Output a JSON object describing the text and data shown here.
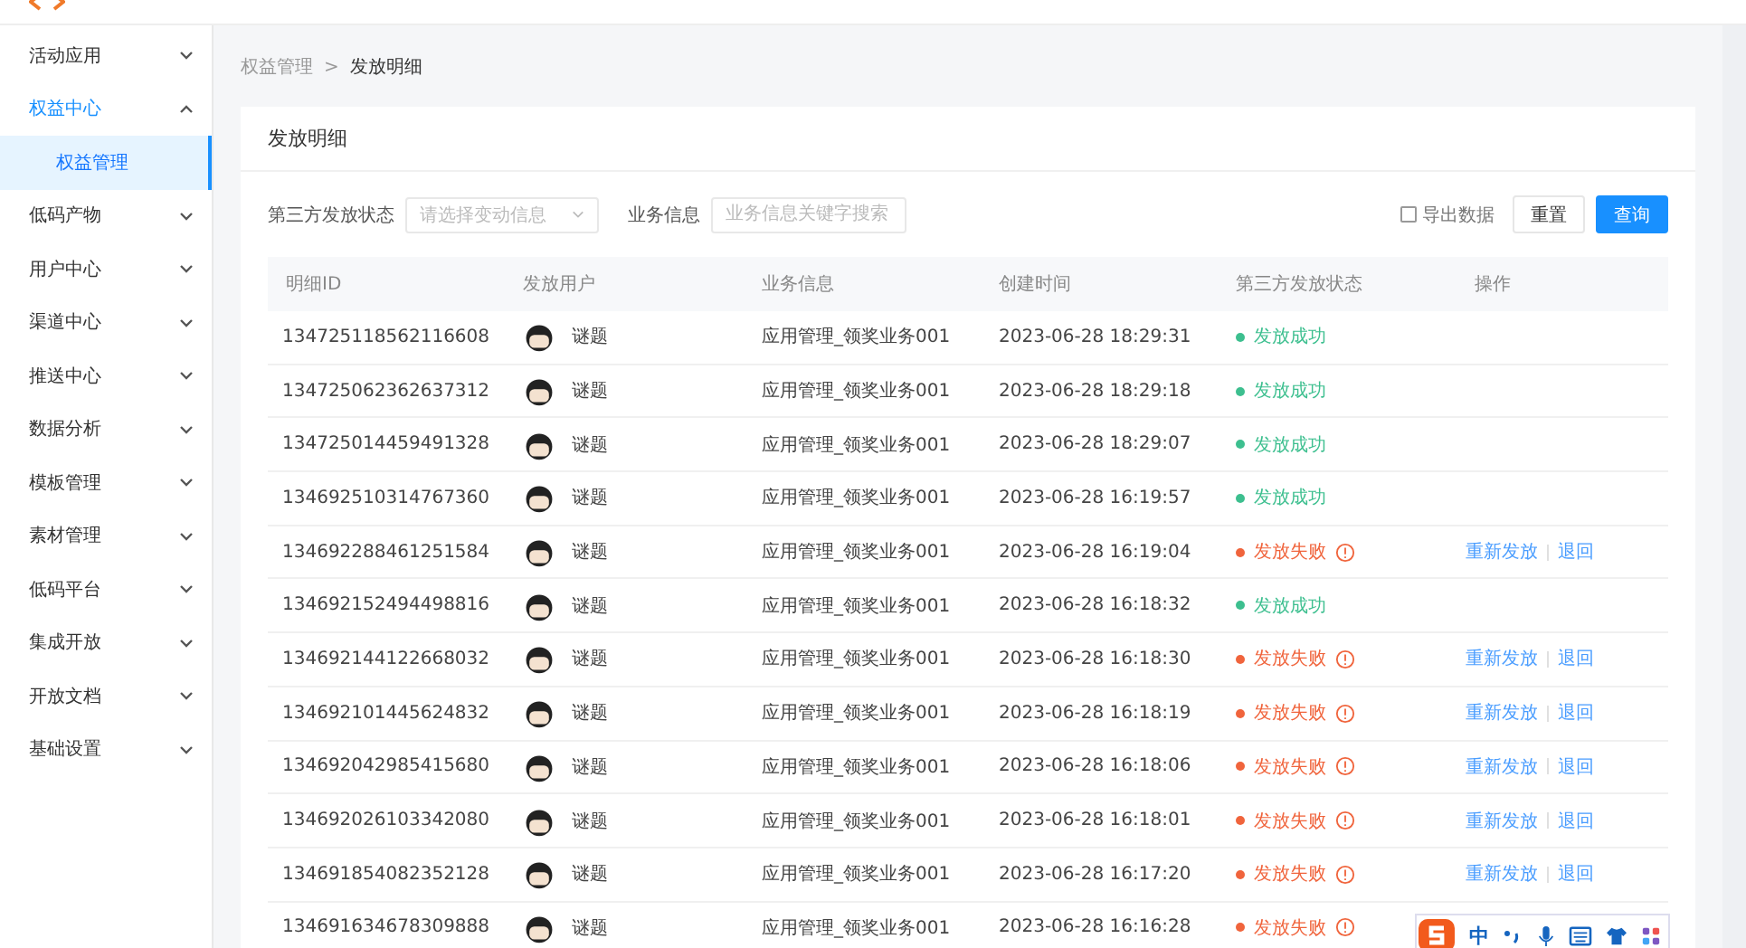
{
  "sidebar": {
    "items": [
      {
        "label": "活动应用",
        "expanded": false,
        "selected": false
      },
      {
        "label": "权益中心",
        "expanded": true,
        "selected": true,
        "children": [
          {
            "label": "权益管理",
            "selected": true
          }
        ]
      },
      {
        "label": "低码产物",
        "expanded": false,
        "selected": false
      },
      {
        "label": "用户中心",
        "expanded": false,
        "selected": false
      },
      {
        "label": "渠道中心",
        "expanded": false,
        "selected": false
      },
      {
        "label": "推送中心",
        "expanded": false,
        "selected": false
      },
      {
        "label": "数据分析",
        "expanded": false,
        "selected": false
      },
      {
        "label": "模板管理",
        "expanded": false,
        "selected": false
      },
      {
        "label": "素材管理",
        "expanded": false,
        "selected": false
      },
      {
        "label": "低码平台",
        "expanded": false,
        "selected": false
      },
      {
        "label": "集成开放",
        "expanded": false,
        "selected": false
      },
      {
        "label": "开放文档",
        "expanded": false,
        "selected": false
      },
      {
        "label": "基础设置",
        "expanded": false,
        "selected": false
      }
    ]
  },
  "breadcrumb": [
    "权益管理",
    ">",
    "发放明细"
  ],
  "card": {
    "title": "发放明细"
  },
  "filters": [
    {
      "label": "第三方发放状态",
      "kind": "select",
      "placeholder": "请选择变动信息"
    },
    {
      "label": "业务信息",
      "kind": "text",
      "placeholder": "业务信息关键字搜索"
    }
  ],
  "export": {
    "label": "导出数据",
    "checked": false
  },
  "buttons": [
    {
      "label": "重置",
      "kind": "default"
    },
    {
      "label": "查询",
      "kind": "primary"
    }
  ],
  "table": {
    "columns": [
      "明细ID",
      "发放用户",
      "业务信息",
      "创建时间",
      "第三方发放状态",
      "操作"
    ],
    "rows": [
      {
        "id": "134725118562116608",
        "user": "谜题",
        "info": "应用管理_领奖业务001",
        "time": "2023-06-28 18:29:31",
        "status": "发放成功",
        "kind": "success"
      },
      {
        "id": "134725062362637312",
        "user": "谜题",
        "info": "应用管理_领奖业务001",
        "time": "2023-06-28 18:29:18",
        "status": "发放成功",
        "kind": "success"
      },
      {
        "id": "134725014459491328",
        "user": "谜题",
        "info": "应用管理_领奖业务001",
        "time": "2023-06-28 18:29:07",
        "status": "发放成功",
        "kind": "success"
      },
      {
        "id": "134692510314767360",
        "user": "谜题",
        "info": "应用管理_领奖业务001",
        "time": "2023-06-28 16:19:57",
        "status": "发放成功",
        "kind": "success"
      },
      {
        "id": "134692288461251584",
        "user": "谜题",
        "info": "应用管理_领奖业务001",
        "time": "2023-06-28 16:19:04",
        "status": "发放失败",
        "kind": "failed",
        "actions": [
          "重新发放",
          "退回"
        ]
      },
      {
        "id": "134692152494498816",
        "user": "谜题",
        "info": "应用管理_领奖业务001",
        "time": "2023-06-28 16:18:32",
        "status": "发放成功",
        "kind": "success"
      },
      {
        "id": "134692144122668032",
        "user": "谜题",
        "info": "应用管理_领奖业务001",
        "time": "2023-06-28 16:18:30",
        "status": "发放失败",
        "kind": "failed",
        "actions": [
          "重新发放",
          "退回"
        ]
      },
      {
        "id": "134692101445624832",
        "user": "谜题",
        "info": "应用管理_领奖业务001",
        "time": "2023-06-28 16:18:19",
        "status": "发放失败",
        "kind": "failed",
        "actions": [
          "重新发放",
          "退回"
        ]
      },
      {
        "id": "134692042985415680",
        "user": "谜题",
        "info": "应用管理_领奖业务001",
        "time": "2023-06-28 16:18:06",
        "status": "发放失败",
        "kind": "failed",
        "actions": [
          "重新发放",
          "退回"
        ]
      },
      {
        "id": "134692026103342080",
        "user": "谜题",
        "info": "应用管理_领奖业务001",
        "time": "2023-06-28 16:18:01",
        "status": "发放失败",
        "kind": "failed",
        "actions": [
          "重新发放",
          "退回"
        ]
      },
      {
        "id": "134691854082352128",
        "user": "谜题",
        "info": "应用管理_领奖业务001",
        "time": "2023-06-28 16:17:20",
        "status": "发放失败",
        "kind": "failed",
        "actions": [
          "重新发放",
          "退回"
        ]
      },
      {
        "id": "134691634678309888",
        "user": "谜题",
        "info": "应用管理_领奖业务001",
        "time": "2023-06-28 16:16:28",
        "status": "发放失败",
        "kind": "failed"
      }
    ]
  },
  "ime_toolbar": {
    "label": "中"
  }
}
